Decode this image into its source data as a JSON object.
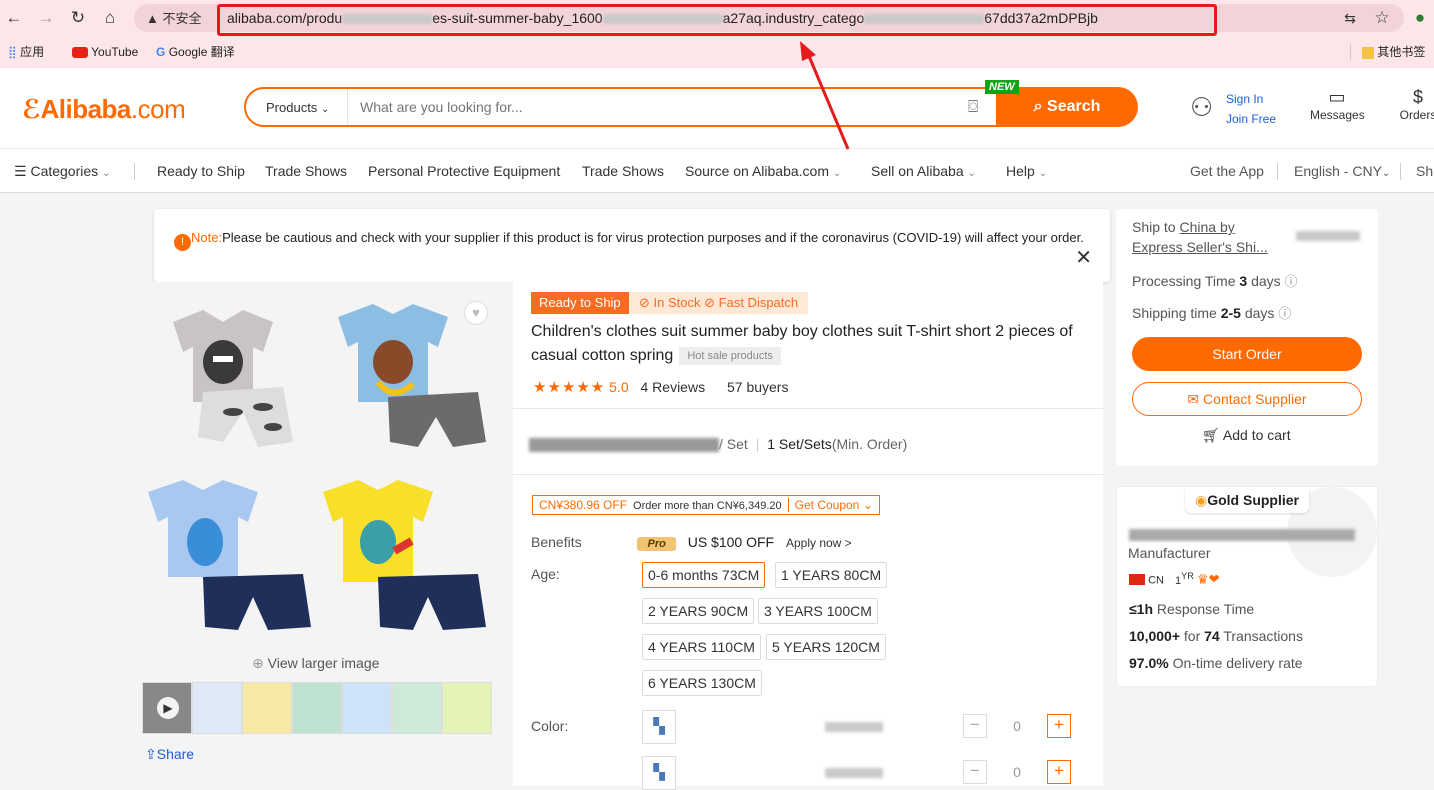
{
  "browser": {
    "insecure_label": "不安全",
    "url_parts": [
      "alibaba.com/produ",
      "es-suit-summer-baby_1600",
      "a27aq.industry_catego",
      "67dd37a2mDPBjb"
    ],
    "bookmarks": [
      "应用",
      "YouTube",
      "Google 翻译",
      "其他书签"
    ]
  },
  "header": {
    "logo": "Alibaba",
    "logo_suffix": ".com",
    "search_category": "Products",
    "search_placeholder": "What are you looking for...",
    "search_button": "Search",
    "new_badge": "NEW",
    "sign_in": "Sign In",
    "join_free": "Join Free",
    "messages": "Messages",
    "orders": "Orders"
  },
  "nav": {
    "categories": "Categories",
    "items": [
      "Ready to Ship",
      "Trade Shows",
      "Personal Protective Equipment",
      "Trade Shows",
      "Source on Alibaba.com",
      "Sell on Alibaba",
      "Help"
    ],
    "get_app": "Get the App",
    "language": "English - CNY",
    "ship_trunc": "Sh"
  },
  "note": {
    "label": "Note:",
    "text": "Please be cautious and check with your supplier if this product is for virus protection purposes and if the coronavirus (COVID-19) will affect your order."
  },
  "gallery": {
    "view_larger": "View larger image",
    "share": "Share"
  },
  "product": {
    "ready_badge": "Ready to Ship",
    "stock_badge": "In Stock",
    "dispatch_badge": "Fast Dispatch",
    "title": "Children's clothes suit summer baby boy clothes suit T-shirt short 2 pieces of casual cotton spring",
    "hot_sale": "Hot sale products",
    "rating": "5.0",
    "reviews": "4 Reviews",
    "buyers": "57 buyers",
    "price_unit": "/ Set",
    "moq": "1 Set/Sets",
    "moq_suffix": "(Min. Order)",
    "coupon_off": "CN¥380.96 OFF",
    "coupon_cond": "Order more than CN¥6,349.20",
    "coupon_get": "Get Coupon",
    "benefits_label": "Benefits",
    "pro_label": "Pro",
    "benefit_text": "US $100 OFF",
    "apply_now": "Apply now >",
    "age_label": "Age:",
    "ages": [
      "0-6 months 73CM",
      "1 YEARS 80CM",
      "2 YEARS 90CM",
      "3 YEARS 100CM",
      "4 YEARS 110CM",
      "5 YEARS 120CM",
      "6 YEARS 130CM"
    ],
    "color_label": "Color:",
    "qty": [
      "0",
      "0"
    ]
  },
  "shipping": {
    "ship_to": "Ship to",
    "ship_country": "China by",
    "ship_method": "Express Seller's Shi...",
    "processing_label": "Processing Time",
    "processing_value": "3",
    "processing_unit": "days",
    "shipping_label": "Shipping time",
    "shipping_value": "2-5",
    "shipping_unit": "days",
    "start_order": "Start Order",
    "contact": "Contact Supplier",
    "add_cart": "Add to cart"
  },
  "supplier": {
    "badge": "Gold Supplier",
    "type": "Manufacturer",
    "country": "CN",
    "years": "1",
    "years_unit": "YR",
    "response_value": "≤1h",
    "response_label": "Response Time",
    "transactions_value": "10,000+",
    "transactions_mid": "for",
    "transactions_count": "74",
    "transactions_label": "Transactions",
    "ontime_value": "97.0%",
    "ontime_label": "On-time delivery rate"
  },
  "colors": {
    "brand": "#ff6a00",
    "link": "#1a5fd6",
    "alert_red": "#e31b1b"
  }
}
